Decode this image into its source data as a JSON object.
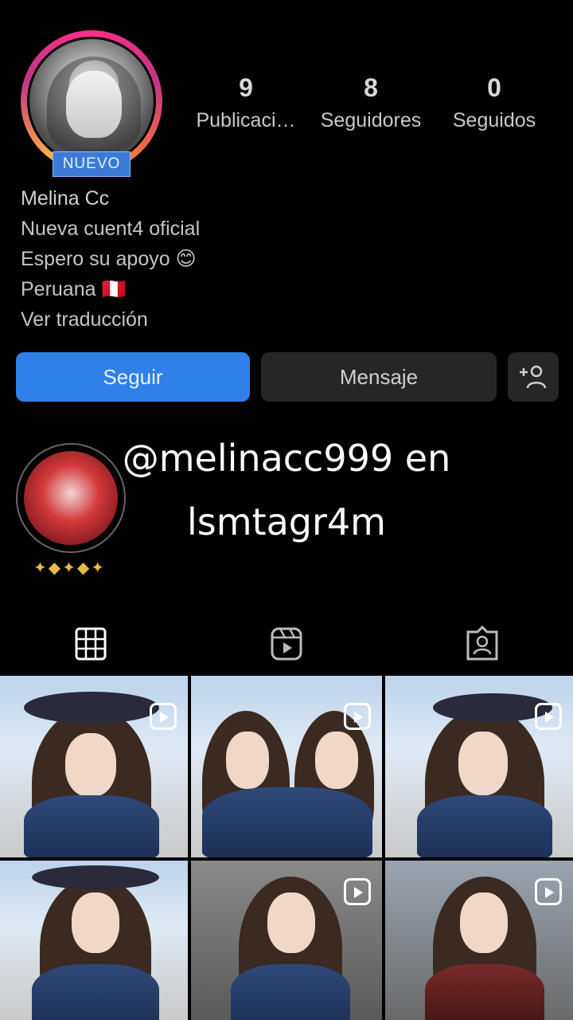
{
  "profile": {
    "badge": "NUEVO",
    "name": "Melina Cc",
    "bio_lines": [
      "Nueva cuent4 oficial",
      "Espero su apoyo 😊",
      "Peruana 🇵🇪"
    ],
    "translate_link": "Ver traducción"
  },
  "stats": [
    {
      "value": "9",
      "label": "Publicaci…"
    },
    {
      "value": "8",
      "label": "Seguidores"
    },
    {
      "value": "0",
      "label": "Seguidos"
    }
  ],
  "buttons": {
    "follow": "Seguir",
    "message": "Mensaje",
    "add_user_icon": "add-user-icon"
  },
  "overlay": {
    "line1": "@melinacc999 en",
    "line2": "lsmtagr4m"
  },
  "tabs": [
    "grid-icon",
    "reels-icon",
    "tagged-icon"
  ],
  "grid": {
    "items": [
      {
        "type": "reel"
      },
      {
        "type": "reel"
      },
      {
        "type": "reel"
      },
      {
        "type": "reel"
      },
      {
        "type": "reel"
      },
      {
        "type": "reel"
      }
    ]
  },
  "colors": {
    "follow_button": "#2f80e8",
    "secondary_button": "#262626",
    "story_ring": "#c13584",
    "background": "#000000"
  }
}
